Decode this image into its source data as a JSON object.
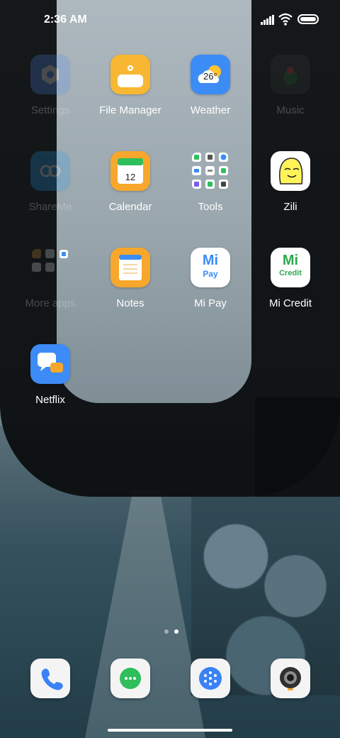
{
  "statusbar": {
    "time": "2:36 AM",
    "icons": [
      "signal-icon",
      "wifi-icon",
      "battery-icon"
    ]
  },
  "apps": [
    {
      "label": "Settings",
      "icon": "settings-icon",
      "color": "#4f8ef7",
      "dimmed": true
    },
    {
      "label": "File Manager",
      "icon": "folder-icon",
      "color": "#f7b733"
    },
    {
      "label": "Weather",
      "icon": "weather-icon",
      "color": "#3c8cf5",
      "temperature": "26°"
    },
    {
      "label": "Music",
      "icon": "music-icon",
      "color": "#3b3b3b",
      "dimmed": true
    },
    {
      "label": "ShareMe",
      "icon": "shareme-icon",
      "color": "#1ea1f2",
      "dimmed": true
    },
    {
      "label": "Calendar",
      "icon": "calendar-icon",
      "color": "#f7a72c",
      "date": "12"
    },
    {
      "label": "Tools",
      "icon": "tools-folder-icon",
      "color": "transparent"
    },
    {
      "label": "Zili",
      "icon": "zili-icon",
      "color": "#fff35a"
    },
    {
      "label": "More apps",
      "icon": "more-apps-folder-icon",
      "color": "transparent",
      "dimmed": true
    },
    {
      "label": "Notes",
      "icon": "notes-icon",
      "color": "#f7a72c"
    },
    {
      "label": "Mi Pay",
      "icon": "mi-pay-icon",
      "color": "#ffffff",
      "mark": "Mi",
      "sub": "Pay"
    },
    {
      "label": "Mi Credit",
      "icon": "mi-credit-icon",
      "color": "#ffffff",
      "mark": "Mi",
      "sub": "Credit"
    },
    {
      "label": "Netflix",
      "icon": "chat-bubbles-icon",
      "color": "#3d8bf6"
    }
  ],
  "dock": [
    {
      "name": "phone-dock-icon",
      "icon": "phone-icon",
      "accent": "#3a82f6"
    },
    {
      "name": "messages-dock-icon",
      "icon": "message-icon",
      "accent": "#2fbe5c"
    },
    {
      "name": "browser-dock-icon",
      "icon": "browser-icon",
      "accent": "#3a82f6"
    },
    {
      "name": "camera-dock-icon",
      "icon": "camera-icon",
      "accent": "#333333"
    }
  ],
  "page_indicator": {
    "pages": 2,
    "current": 2
  }
}
